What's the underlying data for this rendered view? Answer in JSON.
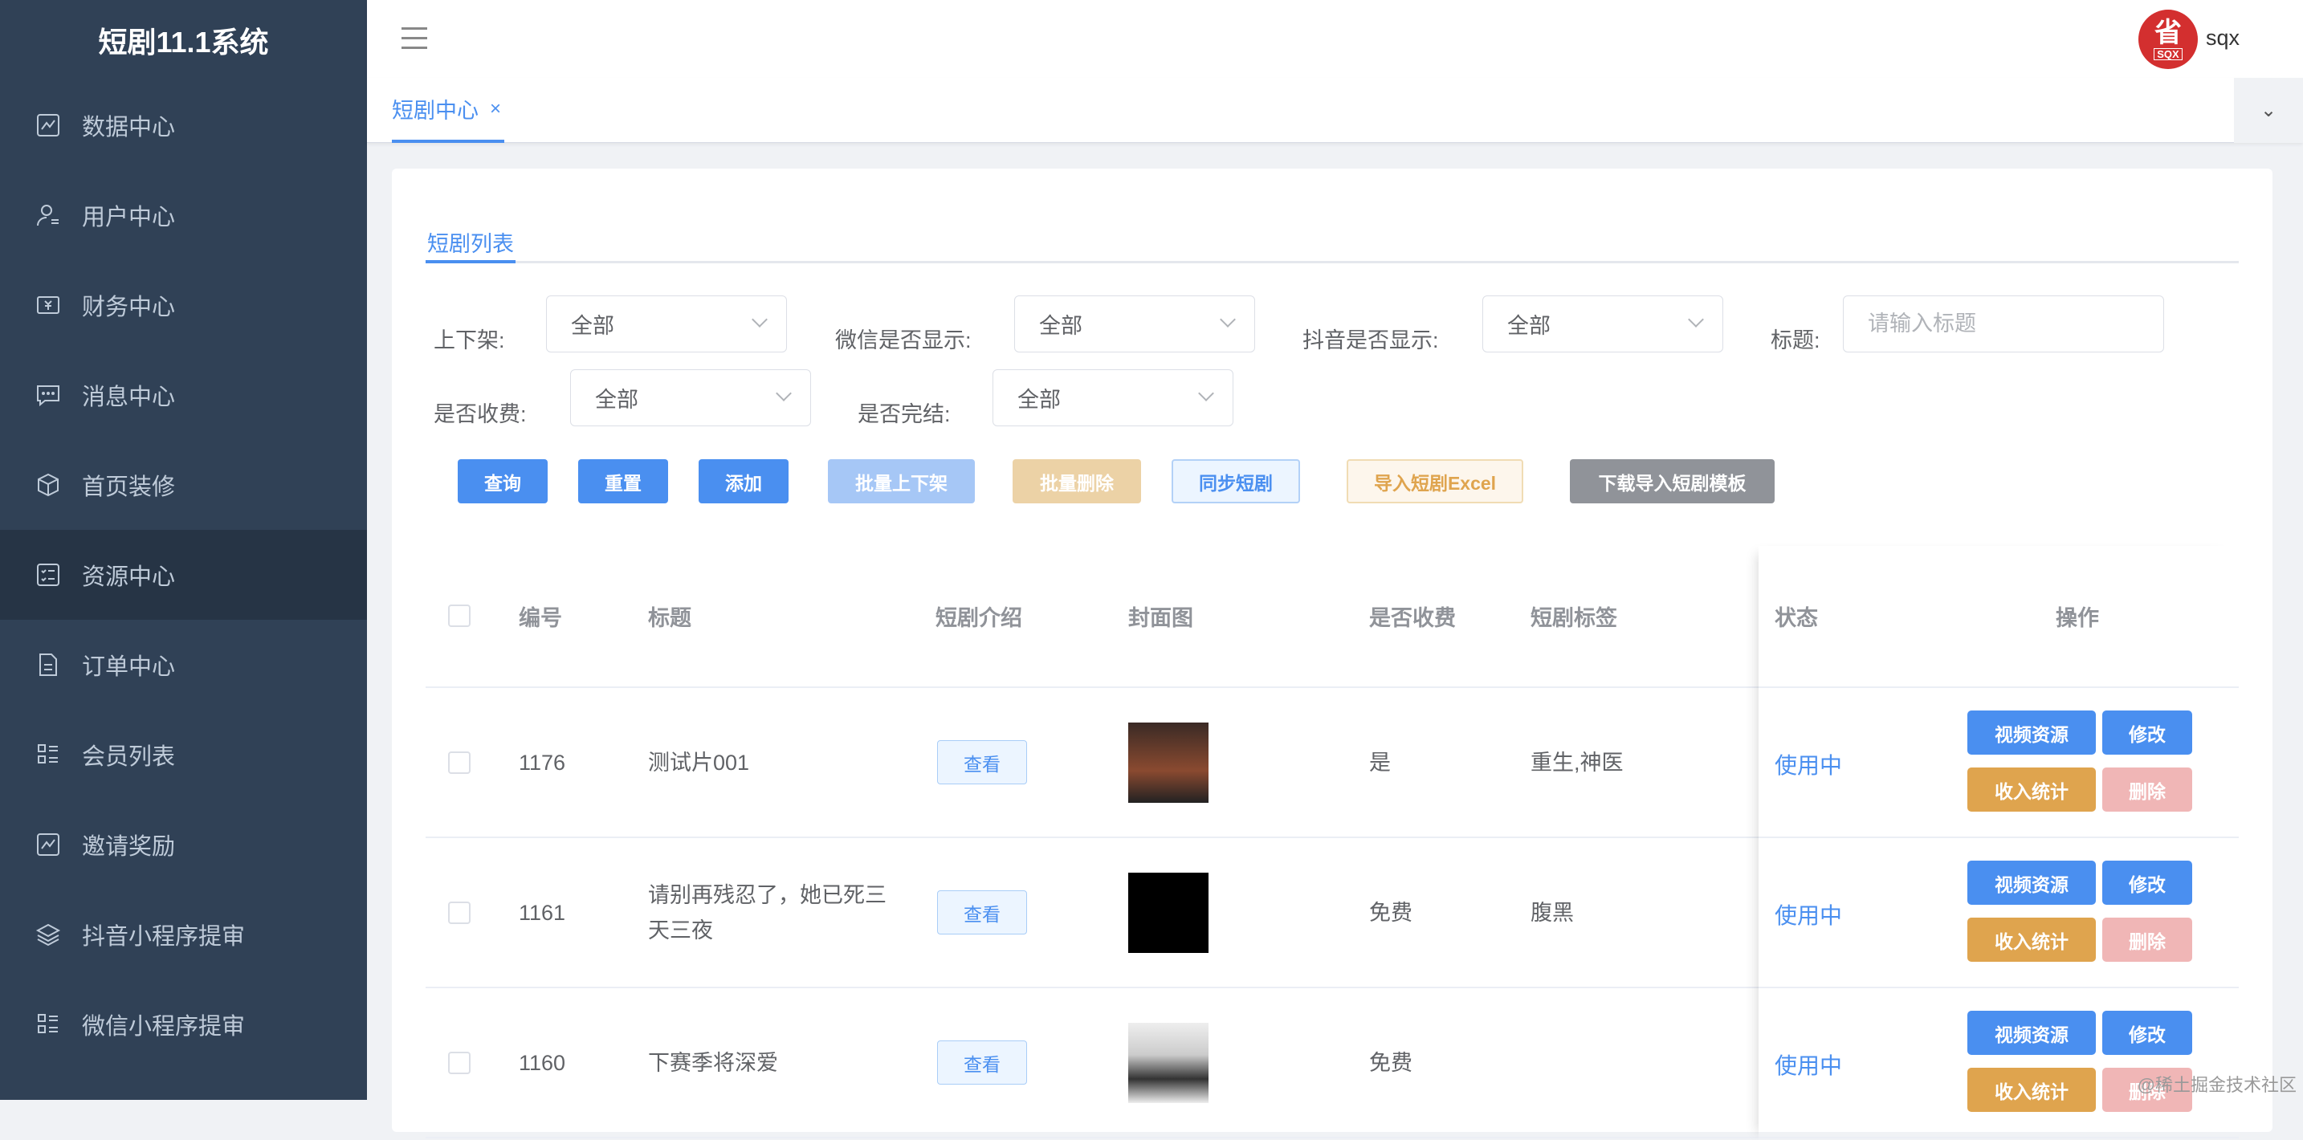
{
  "app": {
    "title": "短剧11.1系统"
  },
  "sidebar": {
    "items": [
      {
        "label": "数据中心",
        "icon": "chart-icon"
      },
      {
        "label": "用户中心",
        "icon": "user-icon"
      },
      {
        "label": "财务中心",
        "icon": "wallet-icon"
      },
      {
        "label": "消息中心",
        "icon": "message-icon"
      },
      {
        "label": "首页装修",
        "icon": "cube-icon"
      },
      {
        "label": "资源中心",
        "icon": "checklist-icon",
        "active": true
      },
      {
        "label": "订单中心",
        "icon": "document-icon"
      },
      {
        "label": "会员列表",
        "icon": "list-icon"
      },
      {
        "label": "邀请奖励",
        "icon": "chart-icon"
      },
      {
        "label": "抖音小程序提审",
        "icon": "layers-icon"
      },
      {
        "label": "微信小程序提审",
        "icon": "list-icon"
      }
    ]
  },
  "header": {
    "user": "sqx",
    "avatar_text": "省",
    "avatar_sub": "SQX"
  },
  "tags": {
    "active": "短剧中心",
    "close": "×",
    "dropdown": "⌄"
  },
  "card": {
    "tab": "短剧列表"
  },
  "filters": {
    "shelf": {
      "label": "上下架:",
      "value": "全部"
    },
    "wechat": {
      "label": "微信是否显示:",
      "value": "全部"
    },
    "douyin": {
      "label": "抖音是否显示:",
      "value": "全部"
    },
    "title": {
      "label": "标题:",
      "placeholder": "请输入标题"
    },
    "paid": {
      "label": "是否收费:",
      "value": "全部"
    },
    "finished": {
      "label": "是否完结:",
      "value": "全部"
    }
  },
  "buttons": {
    "query": "查询",
    "reset": "重置",
    "add": "添加",
    "batch_shelf": "批量上下架",
    "batch_delete": "批量删除",
    "sync": "同步短剧",
    "import": "导入短剧Excel",
    "download": "下载导入短剧模板"
  },
  "colors": {
    "primary": "#4a8ff0",
    "warning": "#dfa44e",
    "danger_disabled": "#f0b6b6",
    "sidebar": "#304156"
  },
  "table": {
    "headers": {
      "id": "编号",
      "title": "标题",
      "intro": "短剧介绍",
      "cover": "封面图",
      "paid": "是否收费",
      "tags": "短剧标签",
      "status": "状态",
      "ops": "操作"
    },
    "rows": [
      {
        "id": "1176",
        "title": "测试片001",
        "intro": "查看",
        "paid": "是",
        "tags": "重生,神医",
        "status": "使用中"
      },
      {
        "id": "1161",
        "title": "请别再残忍了，她已死三天三夜",
        "intro": "查看",
        "paid": "免费",
        "tags": "腹黑",
        "status": "使用中"
      },
      {
        "id": "1160",
        "title": "下赛季将深爱",
        "intro": "查看",
        "paid": "免费",
        "tags": "",
        "status": "使用中"
      }
    ],
    "ops": {
      "video": "视频资源",
      "edit": "修改",
      "income": "收入统计",
      "delete": "删除"
    }
  },
  "watermark": "@稀土掘金技术社区"
}
